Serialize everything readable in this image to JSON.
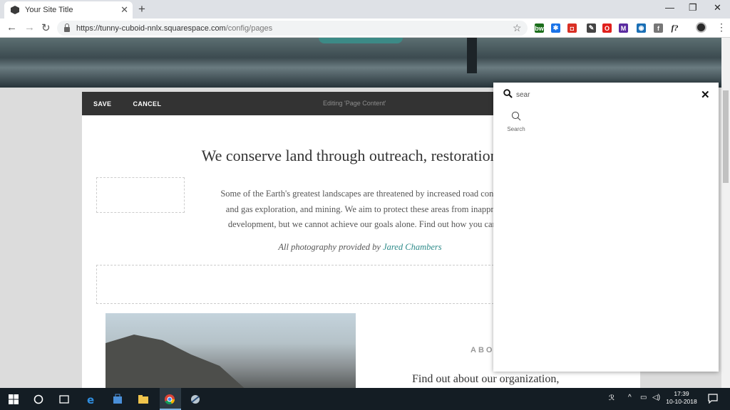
{
  "browser": {
    "tab_title": "Your Site Title",
    "url_host": "https://tunny-cuboid-nnlx.squarespace.com",
    "url_path": "/config/pages",
    "extensions": [
      {
        "icon": "bw-ext-icon",
        "label": "bw",
        "color": "#1b6e1b"
      },
      {
        "icon": "blue-star-ext-icon",
        "label": "✱",
        "color": "#1a73e8"
      },
      {
        "icon": "red-play-ext-icon",
        "label": "◘",
        "color": "#d93025"
      },
      {
        "icon": "eyedropper-ext-icon",
        "label": "✎",
        "color": "#444444"
      },
      {
        "icon": "opera-ext-icon",
        "label": "O",
        "color": "#e0201c"
      },
      {
        "icon": "purple-m-ext-icon",
        "label": "M",
        "color": "#5b2ca0"
      },
      {
        "icon": "blue-square-ext-icon",
        "label": "◉",
        "color": "#1a6fb5"
      },
      {
        "icon": "grey-f-ext-icon",
        "label": "f",
        "color": "#777777"
      },
      {
        "icon": "f-question-ext-icon",
        "label": "f?",
        "color": "#ffffff"
      }
    ]
  },
  "editor": {
    "save_label": "SAVE",
    "cancel_label": "CANCEL",
    "status": "Editing 'Page Content'"
  },
  "page": {
    "headline": "We conserve land through outreach, restoration, an",
    "body_lines": [
      "Some of the Earth's greatest landscapes are threatened by increased road construc",
      "and gas exploration, and mining. We aim to protect these areas from inappropr",
      "development, but we cannot achieve our goals alone. Find out how you can h"
    ],
    "credit_prefix": "All photography provided by",
    "credit_name": "Jared Chambers",
    "about_label": "ABO",
    "about_text": "Find out about our organization,"
  },
  "search": {
    "query": "sear",
    "result_label": "Search"
  },
  "taskbar": {
    "time": "17:39",
    "date": "10-10-2018"
  },
  "colors": {
    "accent_teal": "#2e8b8a",
    "editbar": "#333333"
  }
}
